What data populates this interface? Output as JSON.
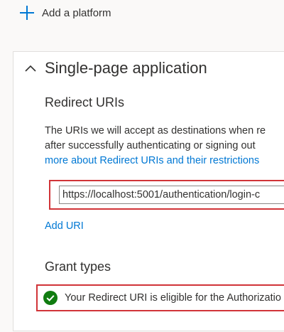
{
  "add_platform": {
    "label": "Add a platform",
    "icon": "plus-icon"
  },
  "platform_card": {
    "title": "Single-page application",
    "collapse_icon": "chevron-up-icon",
    "redirect_uris": {
      "heading": "Redirect URIs",
      "description_line1": "The URIs we will accept as destinations when re",
      "description_line2": "after successfully authenticating or signing out",
      "description_link": "more about Redirect URIs and their restrictions",
      "uris": [
        "https://localhost:5001/authentication/login-c"
      ],
      "add_uri_label": "Add URI"
    },
    "grant_types": {
      "heading": "Grant types",
      "status_icon": "check-circle-icon",
      "status_text": "Your Redirect URI is eligible for the Authorizatio"
    }
  },
  "colors": {
    "accent": "#0078d4",
    "error_border": "#d13438",
    "success": "#107c10",
    "page_background": "#faf9f8"
  }
}
